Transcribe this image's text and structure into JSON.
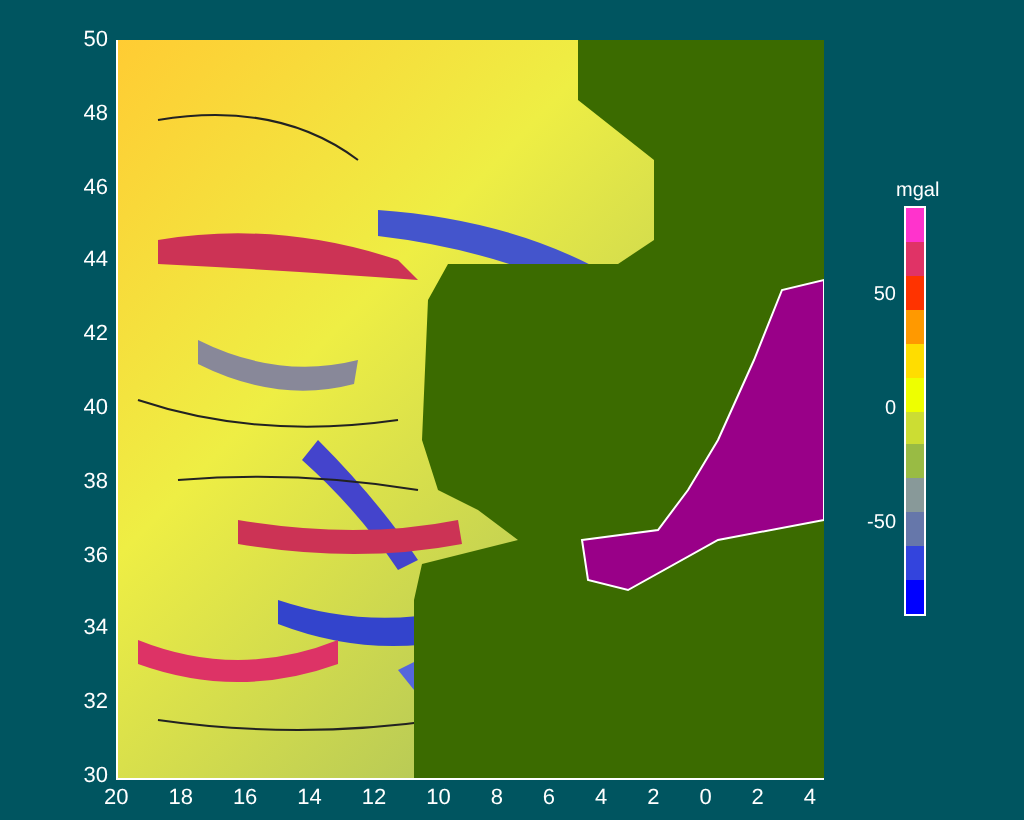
{
  "y_axis_labels": [
    "50",
    "48",
    "46",
    "44",
    "42",
    "40",
    "38",
    "36",
    "34",
    "32",
    "30"
  ],
  "x_axis_labels": [
    "20",
    "18",
    "16",
    "14",
    "12",
    "10",
    "8",
    "6",
    "4",
    "2",
    "0",
    "2",
    "4"
  ],
  "colorbar": {
    "unit": "mgal",
    "labels": [
      "50",
      "0",
      "-50"
    ]
  }
}
